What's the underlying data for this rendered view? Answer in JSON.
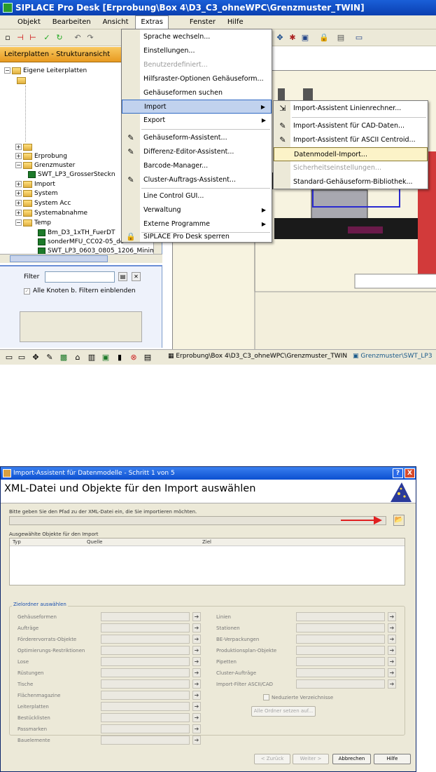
{
  "top": {
    "app_title": "SIPLACE Pro Desk   [Erprobung\\Box 4\\D3_C3_ohneWPC\\Grenzmuster_TWIN]",
    "menu": [
      "Objekt",
      "Bearbeiten",
      "Ansicht",
      "Extras",
      "Fenster",
      "Hilfe"
    ],
    "panel_title": "Leiterplatten - Strukturansicht",
    "tree": [
      "Eigene Leiterplatten",
      "Erprobung",
      "Grenzmuster",
      "SWT_LP3_GrosserSteckn",
      "Import",
      "System",
      "System Acc",
      "Systemabnahme",
      "Temp",
      "Bm_D3_1xTH_FuerDT",
      "sonderMFU_CC02-05_do",
      "SWT_LP3_0603_0805_1206_Minim"
    ],
    "filter_label": "Filter",
    "filter_checkbox": "Alle Knoten b. Filtern einblenden",
    "status_path1": "Erprobung\\Box 4\\D3_C3_ohneWPC\\Grenzmuster_TWIN",
    "status_path2": "Grenzmuster\\SWT_LP3",
    "extras_menu": [
      {
        "label": "Sprache wechseln...",
        "state": "normal"
      },
      {
        "label": "Einstellungen...",
        "state": "normal"
      },
      {
        "label": "Benutzerdefiniert...",
        "state": "disabled"
      },
      {
        "label": "Hilfsraster-Optionen Gehäuseform...",
        "state": "normal"
      },
      {
        "label": "Gehäuseformen suchen",
        "state": "normal"
      },
      {
        "label": "Import",
        "state": "highlight"
      },
      {
        "label": "Export",
        "state": "normal"
      },
      {
        "label": "Gehäuseform-Assistent...",
        "state": "normal"
      },
      {
        "label": "Differenz-Editor-Assistent...",
        "state": "normal"
      },
      {
        "label": "Barcode-Manager...",
        "state": "normal"
      },
      {
        "label": "Cluster-Auftrags-Assistent...",
        "state": "normal"
      },
      {
        "label": "Line Control GUI...",
        "state": "normal"
      },
      {
        "label": "Verwaltung",
        "state": "normal"
      },
      {
        "label": "Externe Programme",
        "state": "normal"
      },
      {
        "label": "SIPLACE Pro Desk sperren",
        "state": "normal"
      }
    ],
    "import_submenu": [
      {
        "label": "Import-Assistent Linienrechner...",
        "state": "normal"
      },
      {
        "label": "Import-Assistent für CAD-Daten...",
        "state": "normal"
      },
      {
        "label": "Import-Assistent für ASCII Centroid...",
        "state": "normal"
      },
      {
        "label": "Datenmodell-Import...",
        "state": "highlight"
      },
      {
        "label": "Sicherheitseinstellungen...",
        "state": "disabled"
      },
      {
        "label": "Standard-Gehäuseform-Bibliothek...",
        "state": "normal"
      }
    ]
  },
  "dialog": {
    "title": "Import-Assistent für Datenmodelle - Schritt 1 von 5",
    "heading": "XML-Datei und Objekte für den Import auswählen",
    "path_instruction": "Bitte geben Sie den Pfad zu der XML-Datei ein, die Sie importieren möchten.",
    "selected_label": "Ausgewählte Objekte für den Import",
    "columns": [
      "Typ",
      "Quelle",
      "Ziel"
    ],
    "group_title": "Zielordner auswählen",
    "left_fields": [
      "Gehäuseformen",
      "Aufträge",
      "Förderervorrats-Objekte",
      "Optimierungs-Restriktionen",
      "Lose",
      "Rüstungen",
      "Tische",
      "Flächenmagazine",
      "Leiterplatten",
      "Bestücklisten",
      "Passmarken",
      "Bauelemente"
    ],
    "right_fields": [
      "Linien",
      "Stationen",
      "BE-Verpackungen",
      "Produktionsplan-Objekte",
      "Pipetten",
      "Cluster-Aufträge",
      "Import-Filter ASCII/CAD"
    ],
    "checkbox_label": "Neduzierte Verzeichnisse",
    "set_all_button": "Alle Ordner setzen auf...",
    "buttons": {
      "back": "< Zurück",
      "next": "Weiter >",
      "cancel": "Abbrechen",
      "help": "Hilfe"
    },
    "help_btn": "?",
    "close_btn": "X"
  }
}
